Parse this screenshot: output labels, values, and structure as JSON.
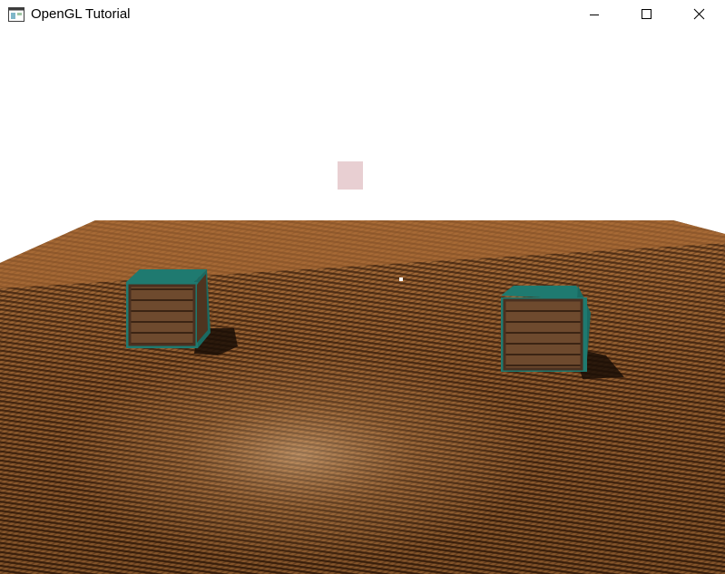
{
  "window": {
    "title": "OpenGL Tutorial",
    "app_icon": "window-app-icon",
    "controls": {
      "minimize_icon": "minimize-icon",
      "maximize_icon": "maximize-icon",
      "close_icon": "close-icon"
    }
  },
  "scene": {
    "background_color": "#ffffff",
    "light_color": "#e8cfd2",
    "floor_colors": {
      "light": "#b57840",
      "dark": "#2a1508"
    },
    "crate_outline_color": "#1f7a70",
    "crate_wood_color": "#6e4a2e",
    "shadow_color": "#1a0e06"
  }
}
